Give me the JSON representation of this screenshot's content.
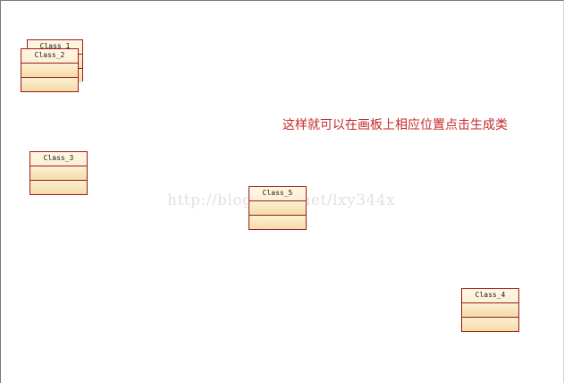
{
  "canvas": {
    "instruction_text": "这样就可以在画板上相应位置点击生成类",
    "watermark": "http://blog.csdn.net/lxy344x"
  },
  "classes": [
    {
      "name": "Class_1"
    },
    {
      "name": "Class_2"
    },
    {
      "name": "Class_3"
    },
    {
      "name": "Class_5"
    },
    {
      "name": "Class_4"
    }
  ],
  "colors": {
    "class_border": "#9b1c1c",
    "class_fill_top": "#fff7e4",
    "class_fill_bottom": "#f6deb0",
    "instruction_text": "#c62828"
  }
}
